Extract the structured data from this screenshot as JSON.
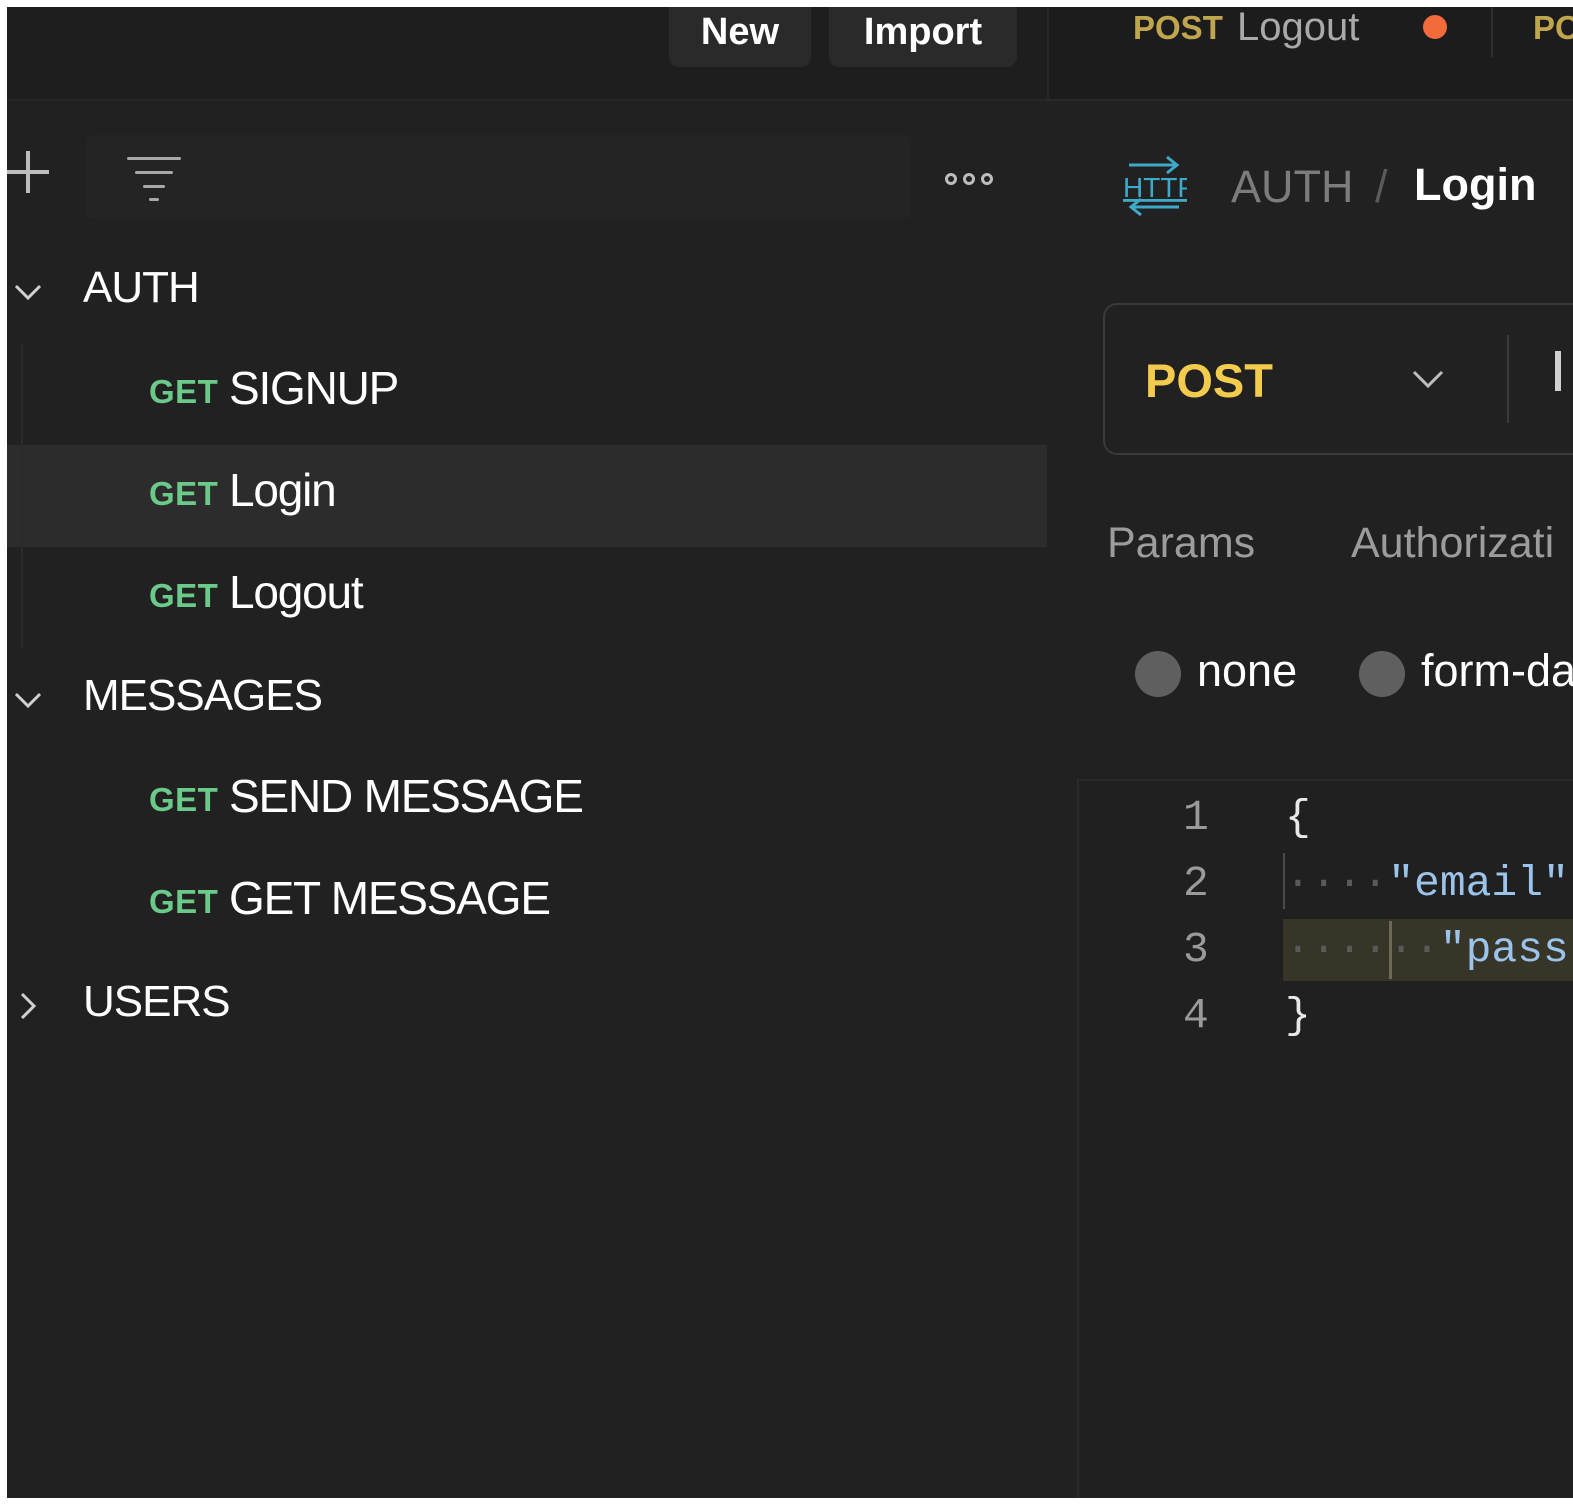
{
  "toolbar": {
    "new_label": "New",
    "import_label": "Import"
  },
  "tabs": [
    {
      "method": "POST",
      "name": "Logout",
      "unsaved": true
    },
    {
      "method": "PO",
      "name": ""
    }
  ],
  "sidebar": {
    "folders": [
      {
        "name": "AUTH",
        "expanded": true,
        "requests": [
          {
            "method": "GET",
            "name": "SIGNUP"
          },
          {
            "method": "GET",
            "name": "Login",
            "selected": true
          },
          {
            "method": "GET",
            "name": "Logout"
          }
        ]
      },
      {
        "name": "MESSAGES",
        "expanded": true,
        "requests": [
          {
            "method": "GET",
            "name": "SEND MESSAGE"
          },
          {
            "method": "GET",
            "name": "GET MESSAGE"
          }
        ]
      },
      {
        "name": "USERS",
        "expanded": false,
        "requests": []
      }
    ]
  },
  "breadcrumb": {
    "icon_text": "HTTP",
    "parent": "AUTH",
    "separator": "/",
    "current": "Login"
  },
  "request": {
    "method": "POST",
    "tabs": [
      "Params",
      "Authorizati"
    ],
    "body_types": [
      "none",
      "form-da"
    ],
    "body_lines": [
      {
        "num": "1",
        "text": "{"
      },
      {
        "num": "2",
        "text": "\"email\""
      },
      {
        "num": "3",
        "text": "\"pass"
      },
      {
        "num": "4",
        "text": "}"
      }
    ]
  },
  "colors": {
    "get": "#6bc98a",
    "post": "#f3cc4d",
    "post_tab": "#bfa64e",
    "unsaved_dot": "#f26b3a",
    "http_icon": "#3fa9c9",
    "json_key": "#9cc3ea"
  },
  "icons": {
    "add": "plus-icon",
    "filter": "filter-icon",
    "more": "more-icon",
    "expanded": "chevron-down-icon",
    "collapsed": "chevron-right-icon",
    "request_type": "http-icon"
  }
}
